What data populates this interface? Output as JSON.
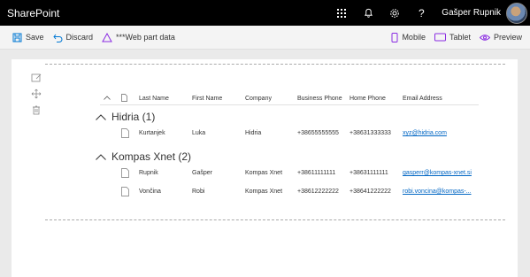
{
  "suite": {
    "brand": "SharePoint",
    "user_name": "Gašper Rupnik",
    "help_glyph": "?"
  },
  "commands": {
    "save": "Save",
    "discard": "Discard",
    "web_part_data": "***Web part data",
    "mobile": "Mobile",
    "tablet": "Tablet",
    "preview": "Preview"
  },
  "list": {
    "columns": [
      "Last Name",
      "First Name",
      "Company",
      "Business Phone",
      "Home Phone",
      "Email Address"
    ],
    "groups": [
      {
        "title": "Hidria (1)",
        "rows": [
          {
            "last": "Kurtanjek",
            "first": "Luka",
            "company": "Hidria",
            "business_phone": "+38655555555",
            "home_phone": "+38631333333",
            "email": "xyz@hidria.com"
          }
        ]
      },
      {
        "title": "Kompas Xnet (2)",
        "rows": [
          {
            "last": "Rupnik",
            "first": "Gašper",
            "company": "Kompas Xnet",
            "business_phone": "+38611111111",
            "home_phone": "+38631111111",
            "email": "gasperr@kompas-xnet.si"
          },
          {
            "last": "Vončina",
            "first": "Robi",
            "company": "Kompas Xnet",
            "business_phone": "+38612222222",
            "home_phone": "+38641222222",
            "email": "robi.voncina@kompas-..."
          }
        ]
      }
    ]
  },
  "colors": {
    "suite_bar": "#000000",
    "accent": "#0078d4",
    "link": "#0066c4",
    "warning": "#8a2be2"
  },
  "icons": [
    "waffle-icon",
    "bell-icon",
    "gear-icon",
    "help-icon",
    "save-icon",
    "undo-icon",
    "warning-icon",
    "mobile-icon",
    "tablet-icon",
    "preview-icon",
    "edit-icon",
    "move-icon",
    "delete-icon",
    "chevron-up-icon",
    "document-icon"
  ]
}
